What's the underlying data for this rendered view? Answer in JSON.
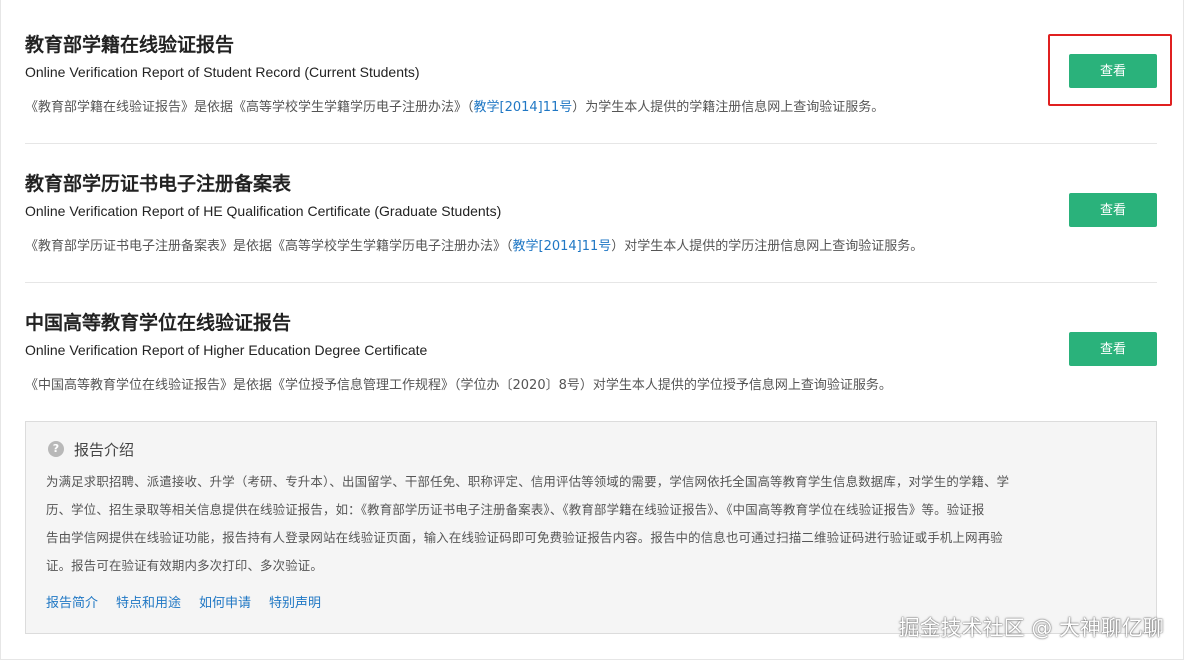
{
  "reports": [
    {
      "title": "教育部学籍在线验证报告",
      "subtitle": "Online Verification Report of Student Record (Current Students)",
      "desc_before": "《教育部学籍在线验证报告》是依据《高等学校学生学籍学历电子注册办法》（",
      "desc_link": "教学[2014]11号",
      "desc_after": "）为学生本人提供的学籍注册信息网上查询验证服务。",
      "button": "查看"
    },
    {
      "title": "教育部学历证书电子注册备案表",
      "subtitle": "Online Verification Report of HE Qualification Certificate (Graduate Students)",
      "desc_before": "《教育部学历证书电子注册备案表》是依据《高等学校学生学籍学历电子注册办法》（",
      "desc_link": "教学[2014]11号",
      "desc_after": "）对学生本人提供的学历注册信息网上查询验证服务。",
      "button": "查看"
    },
    {
      "title": "中国高等教育学位在线验证报告",
      "subtitle": "Online Verification Report of Higher Education Degree Certificate",
      "desc": "《中国高等教育学位在线验证报告》是依据《学位授予信息管理工作规程》（学位办〔2020〕8号）对学生本人提供的学位授予信息网上查询验证服务。",
      "button": "查看"
    }
  ],
  "intro": {
    "icon": "question-icon",
    "heading": "报告介绍",
    "lines": [
      "为满足求职招聘、派遣接收、升学（考研、专升本）、出国留学、干部任免、职称评定、信用评估等领域的需要，学信网依托全国高等教育学生信息数据库，对学生的学籍、学",
      "历、学位、招生录取等相关信息提供在线验证报告，如：《教育部学历证书电子注册备案表》、《教育部学籍在线验证报告》、《中国高等教育学位在线验证报告》等。验证报",
      "告由学信网提供在线验证功能，报告持有人登录网站在线验证页面，输入在线验证码即可免费验证报告内容。报告中的信息也可通过扫描二维验证码进行验证或手机上网再验",
      "证。报告可在验证有效期内多次打印、多次验证。"
    ],
    "links": [
      "报告简介",
      "特点和用途",
      "如何申请",
      "特别声明"
    ]
  },
  "watermark": "掘金技术社区 @ 大神聊亿聊",
  "colors": {
    "button": "#2ab27b",
    "link": "#1f77c4",
    "highlight": "#e02020"
  }
}
